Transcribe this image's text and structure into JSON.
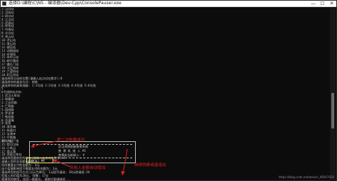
{
  "window": {
    "title": "选择D:\\编程\\C\\NS - 编译器\\Dev-Cpp\\ConsolePauser.exe",
    "minimize": "—",
    "maximize": "☐",
    "close": "✕"
  },
  "console_lines": [
    "1:汉口站",
    "2:汉阳站",
    "3:硚口站",
    "4:江汉站",
    "5:武昌站",
    "6:徐东站",
    "7:中南站",
    "8:光谷站",
    "9:关山站",
    "10:洪山站",
    "11:青山站",
    "12:建设站",
    "13:动物园站",
    "14:东湖站",
    "15:市中心站",
    "16:新华路站",
    "17:循礼门站",
    "18:汉正街站",
    "19:六渡桥站",
    "20:积玉桥站",
    "请选择终点站的位置(请输入站点对应数字):8",
    "请选择你的乘坐方式: 地铁",
    "请选择你的乘车线路: 1:1号线 2:2号线 3:3号线 4:4号线 5:6号线",
    "5",
    "6号线的站点有:",
    "1:武汉火车站",
    "2:杨春湖",
    "3:工业四路",
    "4:仁和路",
    "5:园林路",
    "6:罗家港",
    "7:铁机路",
    "8:岳家嘴",
    "9:东亭",
    "10:青鱼嘴",
    "11:街道口",
    "12:宝通寺",
    "13:中南路",
    "14:洪山广场",
    "15:楚河汉街",
    "16:小龟山",
    "17:首义路",
    "18:武昌火车站",
    "请选择您要前往的地点(请输入站点对应数字):4",
    "请输入您的总金额(单位:元)",
    "您所需要支付的金额为: 4元",
    "由于疫情影响您只需要支付的金额为: 3元",
    "请选择您的投币方式(以元为单位: 1元投币请选: 20元则请投:20",
    "您投入的币值为20元, 找零: 17元",
    "感谢您的使用, 祝您一路顺风, 请按任意键继续..."
  ],
  "prompt": {
    "line1": "第二次购票成功",
    "counter_label": "票号:07"
  },
  "menu": {
    "row1": "武汉地铁智能售票系统",
    "row2": "售 票 机 投 入 ¥5",
    "row3": "售票机当前收入: ¥",
    "total_label": "总收入: ¥",
    "total_value": "8"
  },
  "annotations": {
    "second_purchase": "第二次购票成功",
    "income_added": "总收入金额自动增加",
    "exit_hint": "继续购票或者退出"
  },
  "watermark": "https://blog.csdn.net/weixin_46047020",
  "colors": {
    "console_bg": "#0c0c0c",
    "console_text": "#c8c8c8",
    "annotation_red": "#e02020",
    "highlight_yellow": "#f6e85a"
  }
}
